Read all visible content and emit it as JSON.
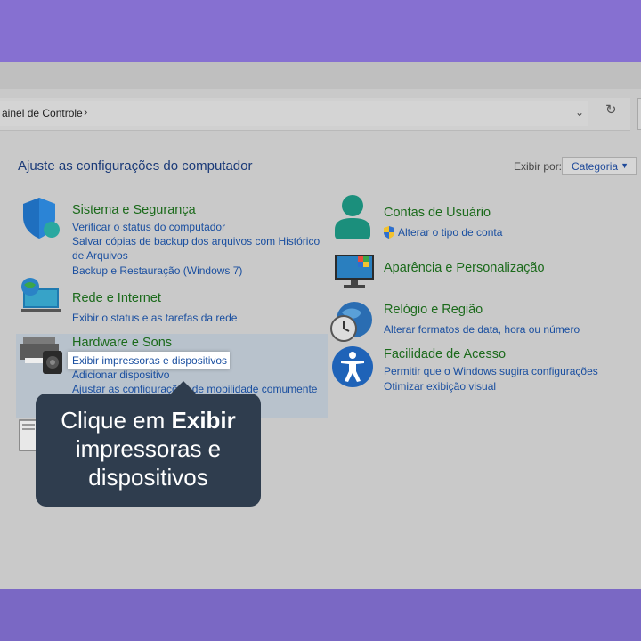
{
  "address": {
    "path": "ainel de Controle",
    "chevron": "›",
    "dropdown": "⌄",
    "refresh": "↻"
  },
  "page": {
    "title": "Ajuste as configurações do computador",
    "view_label": "Exibir por:",
    "view_value": "Categoria",
    "view_caret": "▼"
  },
  "left": [
    {
      "title": "Sistema e Segurança",
      "links": [
        "Verificar o status do computador",
        "Salvar cópias de backup dos arquivos com Histórico",
        "de Arquivos",
        "Backup e Restauração (Windows 7)"
      ]
    },
    {
      "title": "Rede e Internet",
      "links": [
        "Exibir o status e as tarefas da rede"
      ]
    },
    {
      "title": "Hardware e Sons",
      "links": [
        "Exibir impressoras e dispositivos",
        "Adicionar dispositivo",
        "Ajustar as configurações de mobilidade comumente"
      ]
    }
  ],
  "right": [
    {
      "title": "Contas de Usuário",
      "links": [
        "Alterar o tipo de conta"
      ]
    },
    {
      "title": "Aparência e Personalização",
      "links": []
    },
    {
      "title": "Relógio e Região",
      "links": [
        "Alterar formatos de data, hora ou número"
      ]
    },
    {
      "title": "Facilidade de Acesso",
      "links": [
        "Permitir que o Windows sugira configurações",
        "Otimizar exibição visual"
      ]
    }
  ],
  "tooltip": {
    "prefix": "Clique em ",
    "bold": "Exibir",
    "rest": "impressoras e dispositivos"
  },
  "colors": {
    "accent": "#1a4fa0",
    "category": "#1b6a1b",
    "tooltip_bg": "#2f3d4e",
    "frame": "#8a76d2"
  }
}
